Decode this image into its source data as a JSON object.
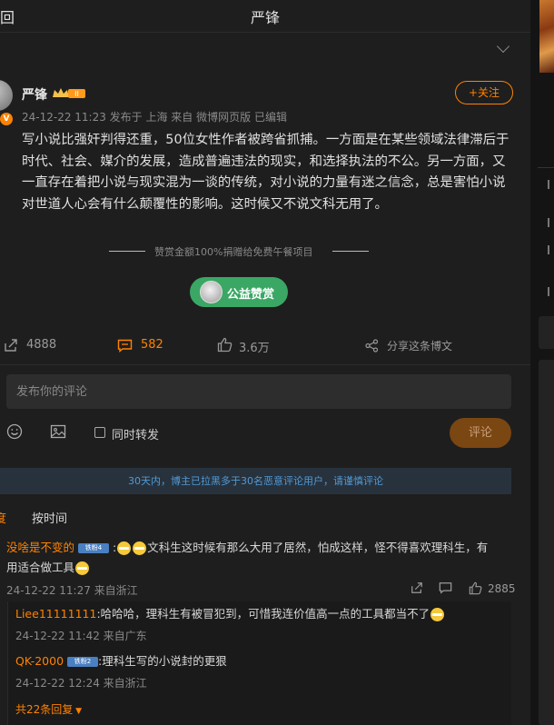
{
  "header": {
    "back_label": "回",
    "title": "严锋"
  },
  "post": {
    "author": "严锋",
    "verified_badge": "V",
    "crown_badge": "II",
    "meta": "24-12-22 11:23  发布于 上海  来自 微博网页版 已编辑",
    "follow_label": "+关注",
    "content": "写小说比强奸判得还重，50位女性作者被跨省抓捕。一方面是在某些领域法律滞后于时代、社会、媒介的发展，造成普遍违法的现实，和选择执法的不公。另一方面，又一直存在着把小说与现实混为一谈的传统，对小说的力量有迷之信念，总是害怕小说对世道人心会有什么颠覆性的影响。这时候又不说文科无用了。",
    "donate_note": "赞赏金额100%捐赠给免费午餐项目",
    "donate_button": "公益赞赏"
  },
  "actions": {
    "repost_count": "4888",
    "comment_count": "582",
    "like_count": "3.6万",
    "share_label": "分享这条博文"
  },
  "composer": {
    "placeholder": "发布你的评论",
    "repost_label": "同时转发",
    "submit_label": "评论"
  },
  "notice": "30天内，博主已拉黑多于30名恶意评论用户，请谨慎评论",
  "sort": {
    "hot": "度",
    "time": "按时间"
  },
  "comments": [
    {
      "name": "没啥是不变的",
      "level": "铁粉4",
      "text_line1": "文科生这时候有那么大用了居然，怕成这样，怪不得喜欢理科生，有",
      "text_line2": "用适合做工具",
      "meta": "24-12-22 11:27 来自浙江",
      "likes": "2885"
    }
  ],
  "replies": [
    {
      "name": "Liee11111111",
      "text": ":哈哈哈，理科生有被冒犯到，可惜我连价值高一点的工具都当不了",
      "meta": "24-12-22 11:42 来自广东"
    },
    {
      "name": "QK-2000",
      "level": "铁粉2",
      "text": ":理科生写的小说封的更狠",
      "meta": "24-12-22 12:24 来自浙江"
    }
  ],
  "more_replies": "共22条回复",
  "colors": {
    "accent": "#ff8200",
    "donate_green": "#3aa764",
    "notice_blue": "#4f9ad8",
    "level_blue": "#4a7fc1"
  }
}
